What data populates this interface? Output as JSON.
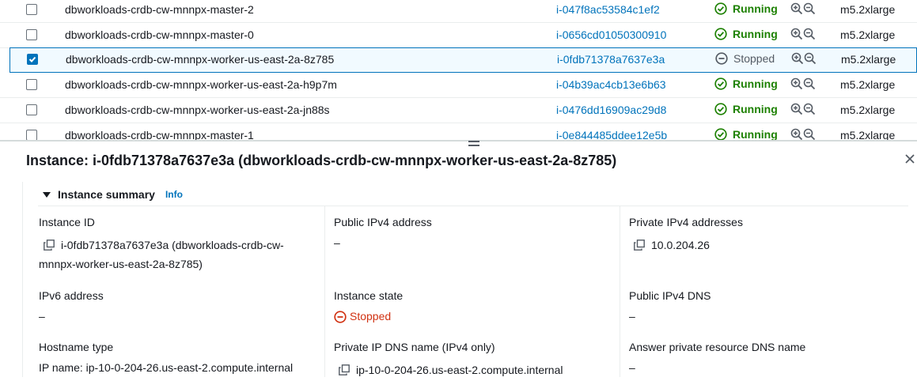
{
  "table": {
    "rows": [
      {
        "name": "dbworkloads-crdb-cw-mnnpx-master-2",
        "id": "i-047f8ac53584c1ef2",
        "state": "Running",
        "type": "m5.2xlarge",
        "selected": false
      },
      {
        "name": "dbworkloads-crdb-cw-mnnpx-master-0",
        "id": "i-0656cd01050300910",
        "state": "Running",
        "type": "m5.2xlarge",
        "selected": false
      },
      {
        "name": "dbworkloads-crdb-cw-mnnpx-worker-us-east-2a-8z785",
        "id": "i-0fdb71378a7637e3a",
        "state": "Stopped",
        "type": "m5.2xlarge",
        "selected": true
      },
      {
        "name": "dbworkloads-crdb-cw-mnnpx-worker-us-east-2a-h9p7m",
        "id": "i-04b39ac4cb13e6b63",
        "state": "Running",
        "type": "m5.2xlarge",
        "selected": false
      },
      {
        "name": "dbworkloads-crdb-cw-mnnpx-worker-us-east-2a-jn88s",
        "id": "i-0476dd16909ac29d8",
        "state": "Running",
        "type": "m5.2xlarge",
        "selected": false
      },
      {
        "name": "dbworkloads-crdb-cw-mnnpx-master-1",
        "id": "i-0e844485ddee12e5b",
        "state": "Running",
        "type": "m5.2xlarge",
        "selected": false
      }
    ]
  },
  "panel": {
    "title": "Instance: i-0fdb71378a7637e3a (dbworkloads-crdb-cw-mnnpx-worker-us-east-2a-8z785)",
    "summary_title": "Instance summary",
    "summary_info": "Info",
    "fields": {
      "instance_id_label": "Instance ID",
      "instance_id_line1": "i-0fdb71378a7637e3a (dbworkloads-crdb-cw-",
      "instance_id_line2": "mnnpx-worker-us-east-2a-8z785)",
      "public_ipv4_label": "Public IPv4 address",
      "public_ipv4_value": "–",
      "private_ipv4_label": "Private IPv4 addresses",
      "private_ipv4_value": "10.0.204.26",
      "ipv6_label": "IPv6 address",
      "ipv6_value": "–",
      "instance_state_label": "Instance state",
      "instance_state_value": "Stopped",
      "public_dns_label": "Public IPv4 DNS",
      "public_dns_value": "–",
      "hostname_type_label": "Hostname type",
      "hostname_type_value": "IP name: ip-10-0-204-26.us-east-2.compute.internal",
      "private_dns_label": "Private IP DNS name (IPv4 only)",
      "private_dns_value": "ip-10-0-204-26.us-east-2.compute.internal",
      "answer_dns_label": "Answer private resource DNS name",
      "answer_dns_value": "–"
    }
  },
  "colors": {
    "link": "#0073bb",
    "running": "#1d8102",
    "stopped": "#d13212",
    "selected_bg": "#f1faff"
  },
  "icons": {
    "checkbox": "checkbox-icon",
    "running": "check-circle-icon",
    "stopped": "minus-circle-icon",
    "zoom_in": "zoom-in-icon",
    "zoom_out": "zoom-out-icon",
    "copy": "copy-icon",
    "close": "close-icon"
  }
}
